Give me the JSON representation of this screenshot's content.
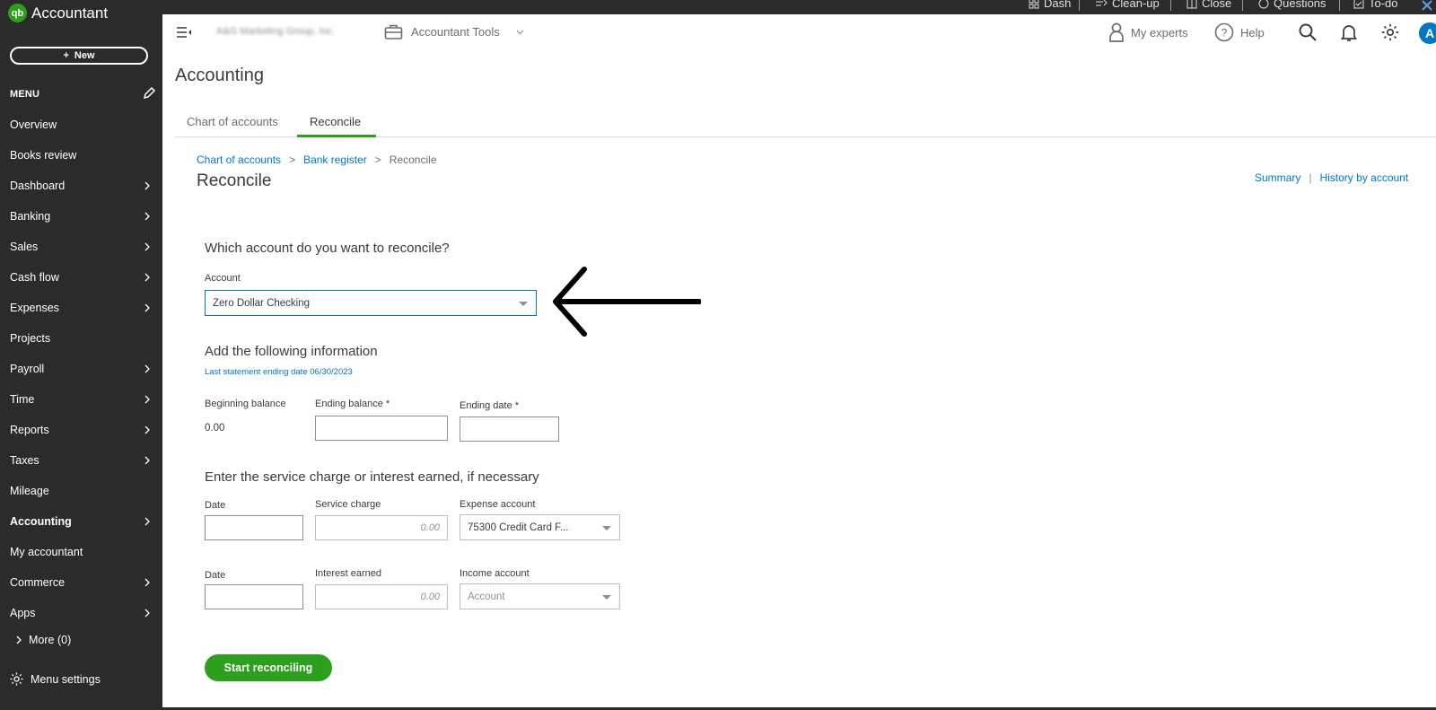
{
  "brand": {
    "logo_mark": "qb",
    "app_name": "Accountant",
    "accent": "#2ca01c",
    "link": "#0077c5",
    "sidebar_bg": "#2b2b2b"
  },
  "topbar": {
    "items": [
      {
        "label": "Dash",
        "icon": "grid-icon"
      },
      {
        "label": "Clean-up",
        "icon": "cleanup-icon"
      },
      {
        "label": "Close",
        "icon": "book-icon"
      },
      {
        "label": "Questions",
        "icon": "chat-icon"
      },
      {
        "label": "To-do",
        "icon": "checklist-icon"
      }
    ]
  },
  "sidebar": {
    "new_label": "New",
    "menu_label": "MENU",
    "items": [
      {
        "label": "Overview",
        "chevron": false
      },
      {
        "label": "Books review",
        "chevron": false
      },
      {
        "label": "Dashboard",
        "chevron": true
      },
      {
        "label": "Banking",
        "chevron": true
      },
      {
        "label": "Sales",
        "chevron": true
      },
      {
        "label": "Cash flow",
        "chevron": true
      },
      {
        "label": "Expenses",
        "chevron": true
      },
      {
        "label": "Projects",
        "chevron": false
      },
      {
        "label": "Payroll",
        "chevron": true
      },
      {
        "label": "Time",
        "chevron": true
      },
      {
        "label": "Reports",
        "chevron": true
      },
      {
        "label": "Taxes",
        "chevron": true
      },
      {
        "label": "Mileage",
        "chevron": false
      },
      {
        "label": "Accounting",
        "chevron": true,
        "active": true
      },
      {
        "label": "My accountant",
        "chevron": false
      },
      {
        "label": "Commerce",
        "chevron": true
      },
      {
        "label": "Apps",
        "chevron": true
      }
    ],
    "more_label": "More (0)",
    "settings_label": "Menu settings"
  },
  "header": {
    "company_name": "A&G Marketing Group, Inc.",
    "accountant_tools": "Accountant Tools",
    "my_experts": "My experts",
    "help": "Help",
    "avatar_initial": "A"
  },
  "page": {
    "title": "Accounting",
    "tabs": [
      {
        "label": "Chart of accounts"
      },
      {
        "label": "Reconcile"
      }
    ],
    "breadcrumb": [
      "Chart of accounts",
      "Bank register",
      "Reconcile"
    ],
    "breadcrumb_sep": ">",
    "heading": "Reconcile",
    "links": {
      "summary": "Summary",
      "sep": "|",
      "history": "History by account"
    }
  },
  "form": {
    "question": "Which account do you want to reconcile?",
    "account_label": "Account",
    "account_value": "Zero Dollar Checking",
    "info_heading": "Add the following information",
    "last_statement": "Last statement ending date 06/30/2023",
    "beginning_balance_label": "Beginning balance",
    "beginning_balance_value": "0.00",
    "ending_balance_label": "Ending balance *",
    "ending_date_label": "Ending date *",
    "charge_heading": "Enter the service charge or interest earned, if necessary",
    "date_label": "Date",
    "service_charge_label": "Service charge",
    "service_charge_placeholder": "0.00",
    "expense_account_label": "Expense account",
    "expense_account_value": "75300 Credit Card F...",
    "interest_earned_label": "Interest earned",
    "interest_earned_placeholder": "0.00",
    "income_account_label": "Income account",
    "income_account_placeholder": "Account",
    "start_button": "Start reconciling"
  }
}
